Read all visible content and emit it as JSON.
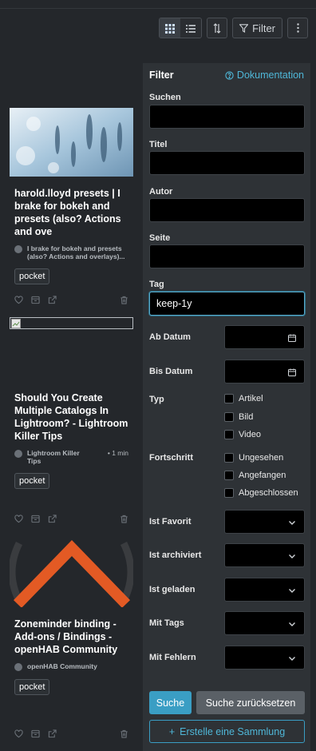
{
  "toolbar": {
    "filter_label": "Filter"
  },
  "cards": [
    {
      "title": "harold.lloyd presets | I brake for bokeh and presets (also? Actions and ove",
      "source": "I brake for bokeh and presets (also? Actions and overlays)...",
      "meta": "",
      "tag": "pocket"
    },
    {
      "title": "Should You Create Multiple Catalogs In Lightroom? - Lightroom Killer Tips",
      "source": "Lightroom Killer Tips",
      "meta": "• 1 min",
      "tag": "pocket"
    },
    {
      "title": "Zoneminder binding - Add-ons / Bindings - openHAB Community",
      "source": "openHAB Community",
      "meta": "",
      "tag": "pocket"
    }
  ],
  "filter": {
    "title": "Filter",
    "doc_link": "Dokumentation",
    "search_label": "Suchen",
    "title_label": "Titel",
    "author_label": "Autor",
    "site_label": "Seite",
    "tag_label": "Tag",
    "tag_value": "keep-1y",
    "from_date_label": "Ab Datum",
    "to_date_label": "Bis Datum",
    "type_label": "Typ",
    "type_options": [
      "Artikel",
      "Bild",
      "Video"
    ],
    "progress_label": "Fortschritt",
    "progress_options": [
      "Ungesehen",
      "Angefangen",
      "Abgeschlossen"
    ],
    "favorite_label": "Ist Favorit",
    "archived_label": "Ist archiviert",
    "loaded_label": "Ist geladen",
    "with_tags_label": "Mit Tags",
    "with_errors_label": "Mit Fehlern",
    "search_button": "Suche",
    "reset_button": "Suche zurücksetzen",
    "create_collection_button": "Erstelle eine Sammlung",
    "accent_color": "#3a9ec4"
  }
}
